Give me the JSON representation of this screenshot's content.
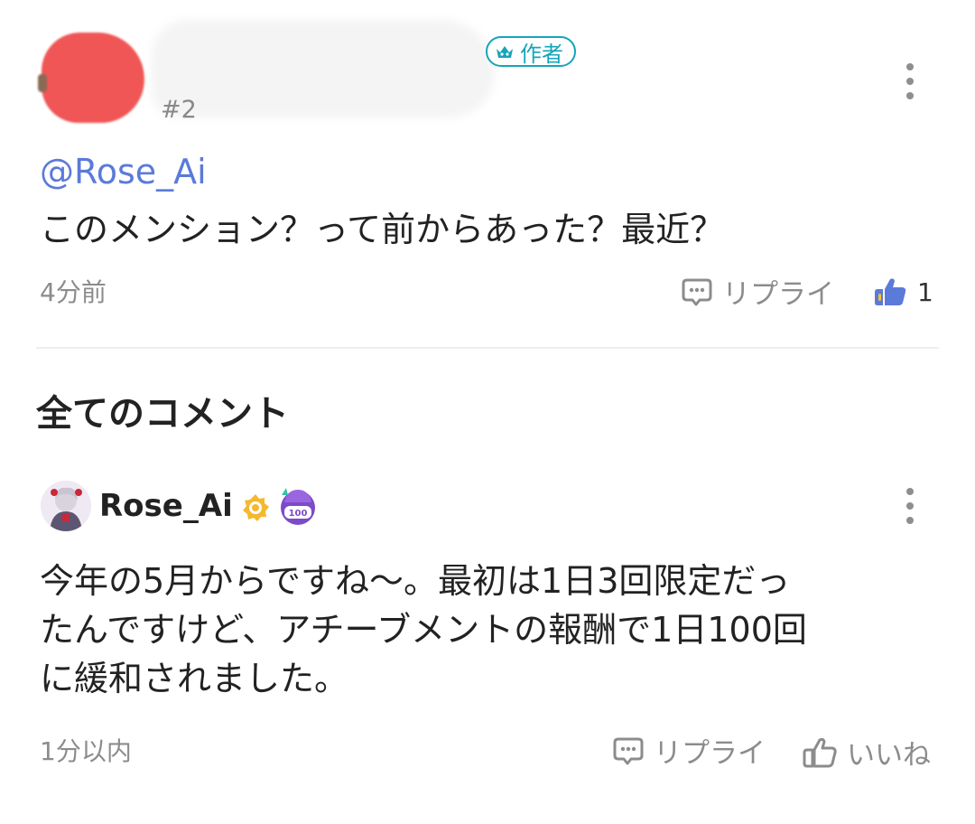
{
  "reply": {
    "author_badge": "作者",
    "number": "#2",
    "mention": "@Rose_Ai",
    "text": "このメンション？って前からあった？最近？",
    "timestamp": "4分前",
    "reply_label": "リプライ",
    "like_count": "1"
  },
  "section": {
    "title": "全てのコメント"
  },
  "comment": {
    "username": "Rose_Ai",
    "lines": [
      "今年の5月からですね〜。最初は1日3回限定だっ",
      "たんですけど、アチーブメントの報酬で1日100回",
      "に緩和されました。"
    ],
    "timestamp": "1分以内",
    "reply_label": "リプライ",
    "like_label": "いいね"
  },
  "colors": {
    "accent_teal": "#15a5b9",
    "mention_blue": "#5b7ad9",
    "like_blue": "#5b7ad9",
    "muted_text": "#8c8c8c",
    "redaction_red": "#f05656"
  },
  "icons": {
    "more": "more-vertical-icon",
    "reply": "chat-bubble-icon",
    "like": "thumbs-up-icon",
    "author": "crown-icon",
    "official": "gold-badge-icon",
    "achievement": "100-achievement-icon"
  }
}
